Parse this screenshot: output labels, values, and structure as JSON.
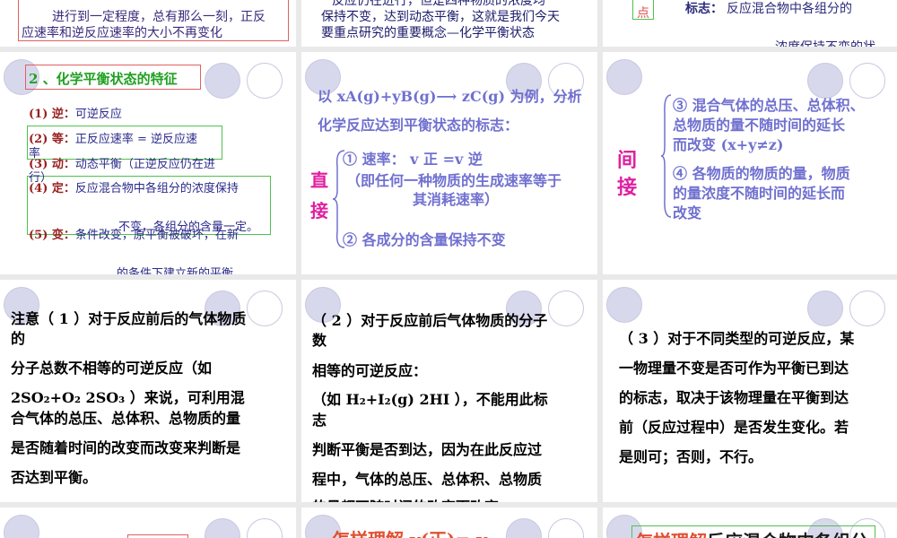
{
  "s1": {
    "line1": "进行到一定程度，总有那么一刻，正反",
    "line2": "应速率和逆反应速率的大小不再变化"
  },
  "s2": {
    "line1": "反应仍在进行，但是四种物质的浓度均",
    "line2": "保持不变，达到动态平衡，这就是我们今天",
    "line3": "要重点研究的重要概念—化学平衡状态"
  },
  "s3": {
    "tag": "点",
    "label": "标志：",
    "text1": "反应混合物中各组分的",
    "text2": "浓度保持不变的状"
  },
  "s4": {
    "title": "2 、化学平衡状态的特征",
    "items": [
      {
        "key": "(1) 逆：",
        "text": "可逆反应"
      },
      {
        "key": "(2) 等：",
        "text": "正反应速率 = 逆反应速"
      },
      {
        "key": "",
        "text": "率"
      },
      {
        "key": "(3) 动：",
        "text": "动态平衡（正逆反应仍在进"
      },
      {
        "key": "",
        "text": "行）"
      },
      {
        "key": "(4) 定：",
        "text": "反应混合物中各组分的浓度保持"
      },
      {
        "key": "",
        "text": "不变，各组分的含量一定。"
      },
      {
        "key": "(5) 变：",
        "text": "条件改变，原平衡被破坏，在新"
      },
      {
        "key": "",
        "text": "的条件下建立新的平衡。"
      }
    ]
  },
  "s5": {
    "intro1": "以 xA(g)+yB(g)⟶ zC(g) 为例，分析",
    "intro2": "化学反应达到平衡状态的标志：",
    "side": "直接",
    "r1": "① 速率：  v 正 =v 逆",
    "r2": "（即任何一种物质的生成速率等于",
    "r3": "其消耗速率）",
    "r4": "② 各成分的含量保持不变"
  },
  "s6": {
    "side": "间接",
    "p1": "③ 混合气体的总压、总体积、",
    "p2": "总物质的量不随时间的延长",
    "p3": "而改变 (x+y≠z)",
    "p4": "④ 各物质的物质的量，物质",
    "p5": "的量浓度不随时间的延长而",
    "p6": "改变"
  },
  "s7": {
    "l1": "注意（ 1 ）对于反应前后的气体物质",
    "l2": "的",
    "l3": "分子总数不相等的可逆反应（如",
    "l4": "2SO₂+O₂      2SO₃ ）来说，可利用混",
    "l5": "合气体的总压、总体积、总物质的量",
    "l6": "是否随着时间的改变而改变来判断是",
    "l7": "否达到平衡。"
  },
  "s8": {
    "l1": "（ 2 ）对于反应前后气体物质的分子",
    "l2": "数",
    "l3": "相等的可逆反应：",
    "l4": "（如 H₂+I₂(g)     2HI ），不能用此标",
    "l5": "志",
    "l6": "判断平衡是否到达，因为在此反应过",
    "l7": "程中，气体的总压、总体积、总物质",
    "l8": "的量都不随时间的改变而改变。"
  },
  "s9": {
    "l1": "（ 3 ）对于不同类型的可逆反应，某",
    "l2": "一物理量不变是否可作为平衡已到达",
    "l3": "的标志，取决于该物理量在平衡到达",
    "l4": "前（反应过程中）是否发生变化。若",
    "l5": "是则可；否则，不行。"
  },
  "s11": {
    "text": "怎样理解 v(正)= v"
  },
  "s12": {
    "hl": "怎样理解",
    "text": "反应混合物中各组分"
  }
}
